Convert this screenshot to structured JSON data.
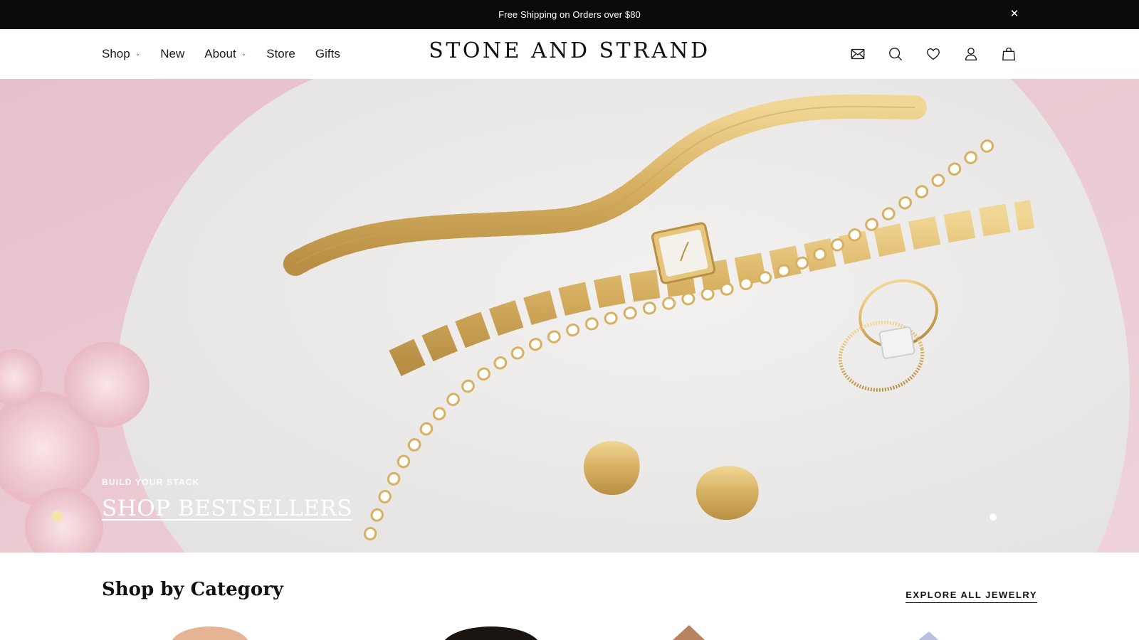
{
  "announcement": {
    "text": "Free Shipping on Orders over $80",
    "close_symbol": "✕"
  },
  "header": {
    "nav": [
      {
        "label": "Shop",
        "has_dropdown": true
      },
      {
        "label": "New",
        "has_dropdown": false
      },
      {
        "label": "About",
        "has_dropdown": true
      },
      {
        "label": "Store",
        "has_dropdown": false
      },
      {
        "label": "Gifts",
        "has_dropdown": false
      }
    ],
    "logo": "STONE AND STRAND",
    "icons": [
      "mail-icon",
      "search-icon",
      "heart-icon",
      "user-icon",
      "bag-icon"
    ]
  },
  "hero": {
    "eyebrow": "BUILD YOUR STACK",
    "cta": "SHOP BESTSELLERS",
    "slide_indicator": {
      "current": 1,
      "total": 1
    }
  },
  "category": {
    "title": "Shop by Category",
    "explore_link": "EXPLORE ALL JEWELRY"
  },
  "colors": {
    "announcement_bg": "#0b0b0b",
    "hero_pink": "#e8c9d1",
    "hero_surface": "#ececec",
    "gold": "#d8b56a"
  }
}
